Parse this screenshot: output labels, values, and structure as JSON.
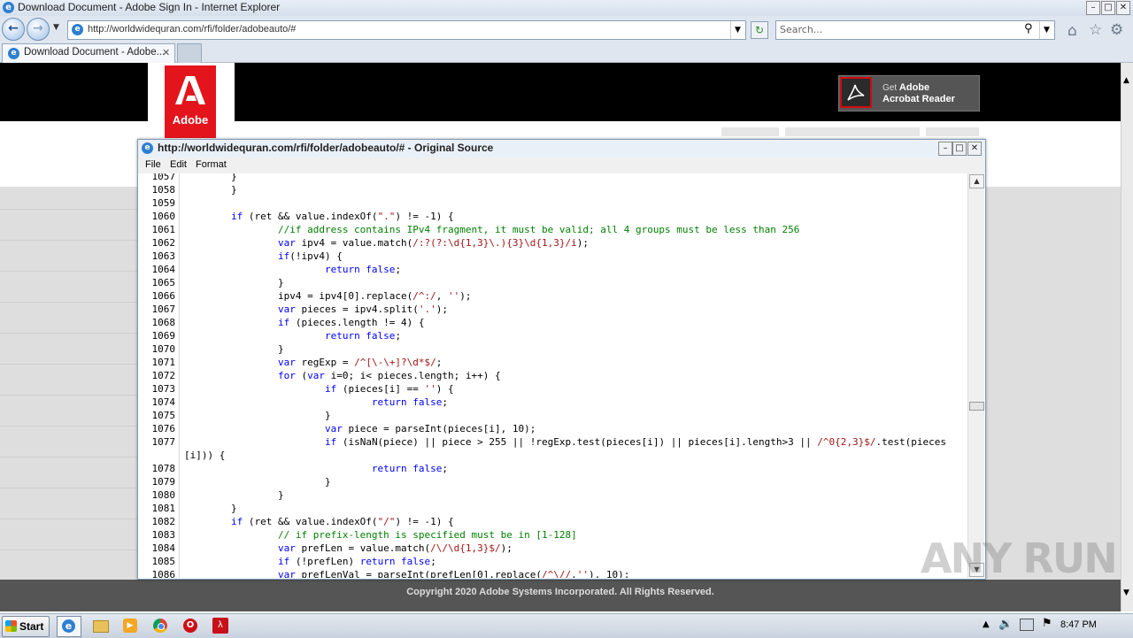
{
  "browser": {
    "window_title": "Download Document - Adobe Sign In - Internet Explorer",
    "address_url": "http://worldwidequran.com/rfi/folder/adobeauto/#",
    "search_placeholder": "Search...",
    "tab_label": "Download Document - Adobe...",
    "back_icon": "back-arrow-icon",
    "forward_icon": "forward-arrow-icon"
  },
  "page": {
    "logo_text": "Adobe",
    "get_reader_line1": "Get",
    "get_reader_line1_bold": "Adobe",
    "get_reader_line2": "Acrobat Reader",
    "copyright": "Copyright 2020 Adobe Systems Incorporated. All Rights Reserved.",
    "accent_red": "#e4141d"
  },
  "source_window": {
    "title": "http://worldwidequran.com/rfi/folder/adobeauto/# - Original Source",
    "menu": [
      "File",
      "Edit",
      "Format"
    ],
    "line_numbers": [
      "1057",
      "1058",
      "1059",
      "1060",
      "1061",
      "1062",
      "1063",
      "1064",
      "1065",
      "1066",
      "1067",
      "1068",
      "1069",
      "1070",
      "1071",
      "1072",
      "1073",
      "1074",
      "1075",
      "1076",
      "1077",
      "",
      "1078",
      "1079",
      "1080",
      "1081",
      "1082",
      "1083",
      "1084",
      "1085",
      "1086"
    ]
  },
  "taskbar": {
    "start_label": "Start",
    "clock": "8:47 PM"
  },
  "watermark": "ANY RUN"
}
